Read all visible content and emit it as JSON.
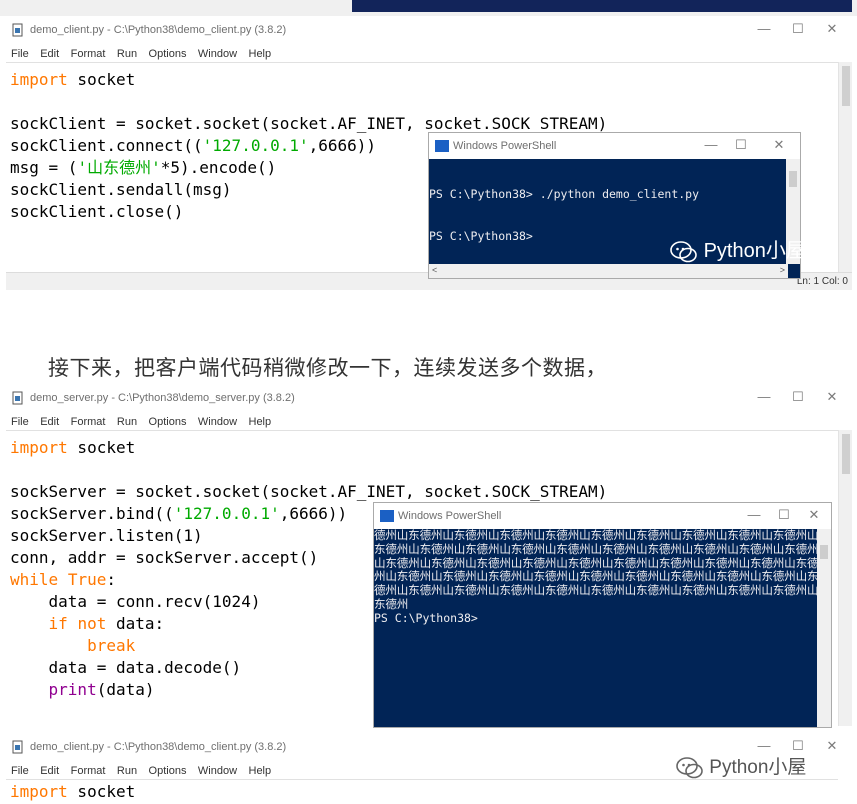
{
  "window1": {
    "title": "demo_client.py - C:\\Python38\\demo_client.py (3.8.2)",
    "menu": [
      "File",
      "Edit",
      "Format",
      "Run",
      "Options",
      "Window",
      "Help"
    ],
    "controls": [
      "—",
      "☐",
      "✕"
    ],
    "status": "Ln: 1  Col: 0",
    "code": [
      [
        {
          "t": "import",
          "c": "kw"
        },
        {
          "t": " socket"
        }
      ],
      [
        {
          "t": ""
        }
      ],
      [
        {
          "t": "sockClient = socket.socket(socket.AF_INET, socket.SOCK_STREAM)"
        }
      ],
      [
        {
          "t": "sockClient.connect(("
        },
        {
          "t": "'127.0.0.1'",
          "c": "str"
        },
        {
          "t": ",6666))"
        }
      ],
      [
        {
          "t": "msg = ("
        },
        {
          "t": "'山东德州'",
          "c": "str"
        },
        {
          "t": "*5).encode()"
        }
      ],
      [
        {
          "t": "sockClient.sendall(msg)"
        }
      ],
      [
        {
          "t": "sockClient.close()"
        }
      ]
    ]
  },
  "ps1": {
    "title": "Windows PowerShell",
    "lines": [
      "PS C:\\Python38> ./python demo_client.py",
      "PS C:\\Python38>"
    ]
  },
  "watermark1": "Python小屋",
  "caption": "接下来，把客户端代码稍微修改一下，连续发送多个数据，",
  "window2": {
    "title": "demo_server.py - C:\\Python38\\demo_server.py (3.8.2)",
    "menu": [
      "File",
      "Edit",
      "Format",
      "Run",
      "Options",
      "Window",
      "Help"
    ],
    "controls": [
      "—",
      "☐",
      "✕"
    ],
    "code": [
      [
        {
          "t": "import",
          "c": "kw"
        },
        {
          "t": " socket"
        }
      ],
      [
        {
          "t": ""
        }
      ],
      [
        {
          "t": "sockServer = socket.socket(socket.AF_INET, socket.SOCK_STREAM)"
        }
      ],
      [
        {
          "t": "sockServer.bind(("
        },
        {
          "t": "'127.0.0.1'",
          "c": "str"
        },
        {
          "t": ",6666))"
        }
      ],
      [
        {
          "t": "sockServer.listen(1)"
        }
      ],
      [
        {
          "t": "conn, addr = sockServer.accept()"
        }
      ],
      [
        {
          "t": "while",
          "c": "kw"
        },
        {
          "t": " "
        },
        {
          "t": "True",
          "c": "kw"
        },
        {
          "t": ":"
        }
      ],
      [
        {
          "t": "    data = conn.recv(1024)"
        }
      ],
      [
        {
          "t": "    "
        },
        {
          "t": "if",
          "c": "kw"
        },
        {
          "t": " "
        },
        {
          "t": "not",
          "c": "kw"
        },
        {
          "t": " data:"
        }
      ],
      [
        {
          "t": "        "
        },
        {
          "t": "break",
          "c": "kw"
        }
      ],
      [
        {
          "t": "    data = data.decode()"
        }
      ],
      [
        {
          "t": "    "
        },
        {
          "t": "print",
          "c": "builtin"
        },
        {
          "t": "(data)"
        }
      ]
    ]
  },
  "ps2": {
    "title": "Windows PowerShell",
    "output": "德州山东德州山东德州山东德州山东德州山东德州山东德州山东德州山东德州山东德州山东德州山东德州山东德州山东德州山东德州山东德州山东德州山东德州山东德州山东德州山东德州山东德州山东德州山东德州山东德州山东德州山东德州山东德州山东德州山东德州山东德州山东德州山东德州山东德州山东德州山东德州山东德州山东德州山东德州山东德州山东德州山东德州山东德州山东德州山东德州山东德州山东德州山东德州山东德州山东德州",
    "prompt": "PS C:\\Python38>"
  },
  "window3": {
    "title": "demo_client.py - C:\\Python38\\demo_client.py (3.8.2)",
    "menu": [
      "File",
      "Edit",
      "Format",
      "Run",
      "Options",
      "Window",
      "Help"
    ],
    "controls": [
      "—",
      "☐",
      "✕"
    ],
    "code": [
      [
        {
          "t": "import",
          "c": "kw"
        },
        {
          "t": " socket"
        }
      ]
    ]
  },
  "watermark2": "Python小屋",
  "colors": {
    "keyword": "#ff7700",
    "string": "#00aa00",
    "builtin": "#900090",
    "powershell_bg": "#012456"
  }
}
